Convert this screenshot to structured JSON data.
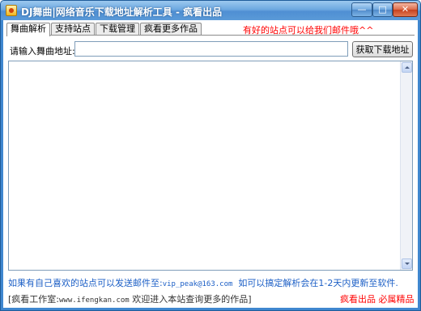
{
  "window": {
    "title": "DJ舞曲|网络音乐下载地址解析工具 - 疯看出品",
    "minimize": "—",
    "maximize": "□",
    "close": "✕"
  },
  "tabs": [
    {
      "label": "舞曲解析",
      "active": true
    },
    {
      "label": "支持站点",
      "active": false
    },
    {
      "label": "下载管理",
      "active": false
    },
    {
      "label": "疯看更多作品",
      "active": false
    }
  ],
  "notice_top": "有好的站点可以给我们邮件哦^^",
  "url_label": "请输入舞曲地址:",
  "url_value": "",
  "fetch_button": "获取下载地址",
  "output_text": "",
  "info": {
    "prefix": "如果有自己喜欢的站点可以发送邮件至:",
    "email": "vip_peak@163.com",
    "suffix": "如可以搞定解析会在1-2天内更新至软件."
  },
  "footer": {
    "prefix": "[疯看工作室:",
    "site": "www.ifengkan.com",
    "suffix": "欢迎进入本站查询更多的作品]",
    "right": "疯看出品 必属精品"
  },
  "colors": {
    "notice": "#ff0000",
    "info": "#1c5fc6",
    "title_bar": "#4f8fd3"
  }
}
